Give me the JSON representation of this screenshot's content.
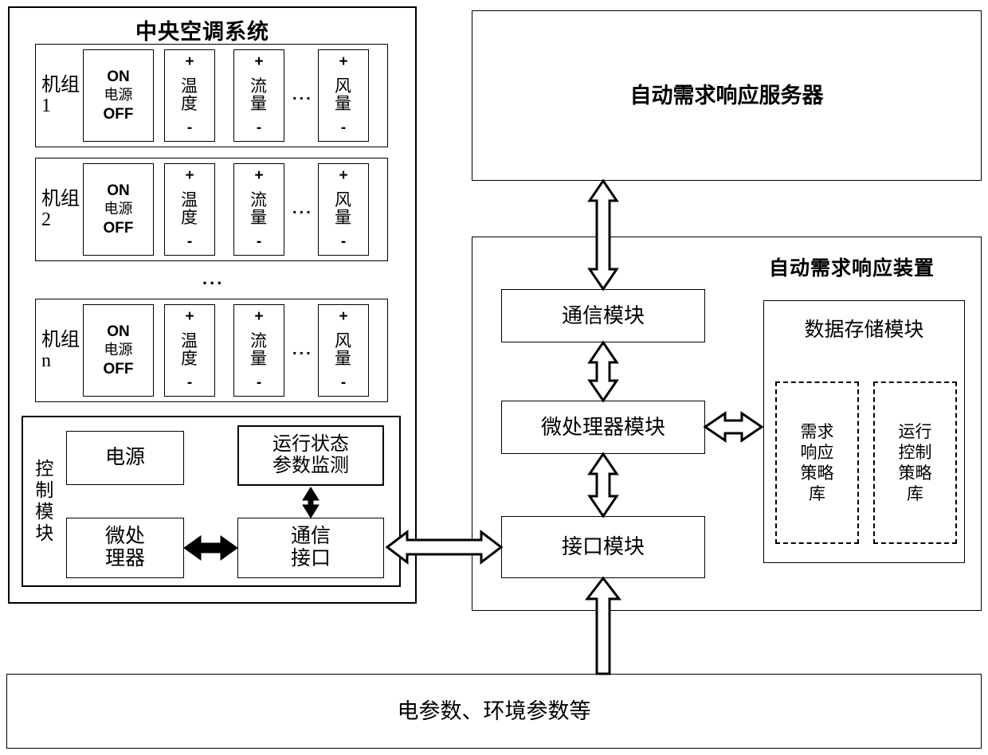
{
  "diagram": {
    "left_panel": {
      "title": "中央空调系统",
      "units": [
        {
          "name": "机组\n1",
          "power": {
            "on": "ON",
            "label": "电源",
            "off": "OFF"
          },
          "controls": [
            {
              "plus": "+",
              "name": "温\n度",
              "minus": "-"
            },
            {
              "plus": "+",
              "name": "流\n量",
              "minus": "-"
            },
            {
              "plus": "+",
              "name": "风\n量",
              "minus": "-"
            }
          ],
          "ellipsis": "..."
        },
        {
          "name": "机组\n2",
          "power": {
            "on": "ON",
            "label": "电源",
            "off": "OFF"
          },
          "controls": [
            {
              "plus": "+",
              "name": "温\n度",
              "minus": "-"
            },
            {
              "plus": "+",
              "name": "流\n量",
              "minus": "-"
            },
            {
              "plus": "+",
              "name": "风\n量",
              "minus": "-"
            }
          ],
          "ellipsis": "..."
        },
        {
          "name": "机组\nn",
          "power": {
            "on": "ON",
            "label": "电源",
            "off": "OFF"
          },
          "controls": [
            {
              "plus": "+",
              "name": "温\n度",
              "minus": "-"
            },
            {
              "plus": "+",
              "name": "流\n量",
              "minus": "-"
            },
            {
              "plus": "+",
              "name": "风\n量",
              "minus": "-"
            }
          ],
          "ellipsis": "..."
        }
      ],
      "units_ellipsis": "...",
      "control_module": {
        "title": "控制模块",
        "power_supply": "电源",
        "status_monitor": "运行状态\n参数监测",
        "microprocessor": "微处\n理器",
        "comm_interface": "通信\n接口"
      }
    },
    "server": {
      "title": "自动需求响应服务器"
    },
    "device": {
      "title": "自动需求响应装置",
      "comm_module": "通信模块",
      "mcu_module": "微处理器模块",
      "interface_module": "接口模块",
      "storage": {
        "title": "数据存储模块",
        "libraries": [
          "需求\n响应\n策略\n库",
          "运行\n控制\n策略\n库"
        ]
      }
    },
    "bottom_bar": {
      "label": "电参数、环境参数等"
    },
    "colors": {
      "line": "#000000",
      "background": "#ffffff"
    }
  }
}
